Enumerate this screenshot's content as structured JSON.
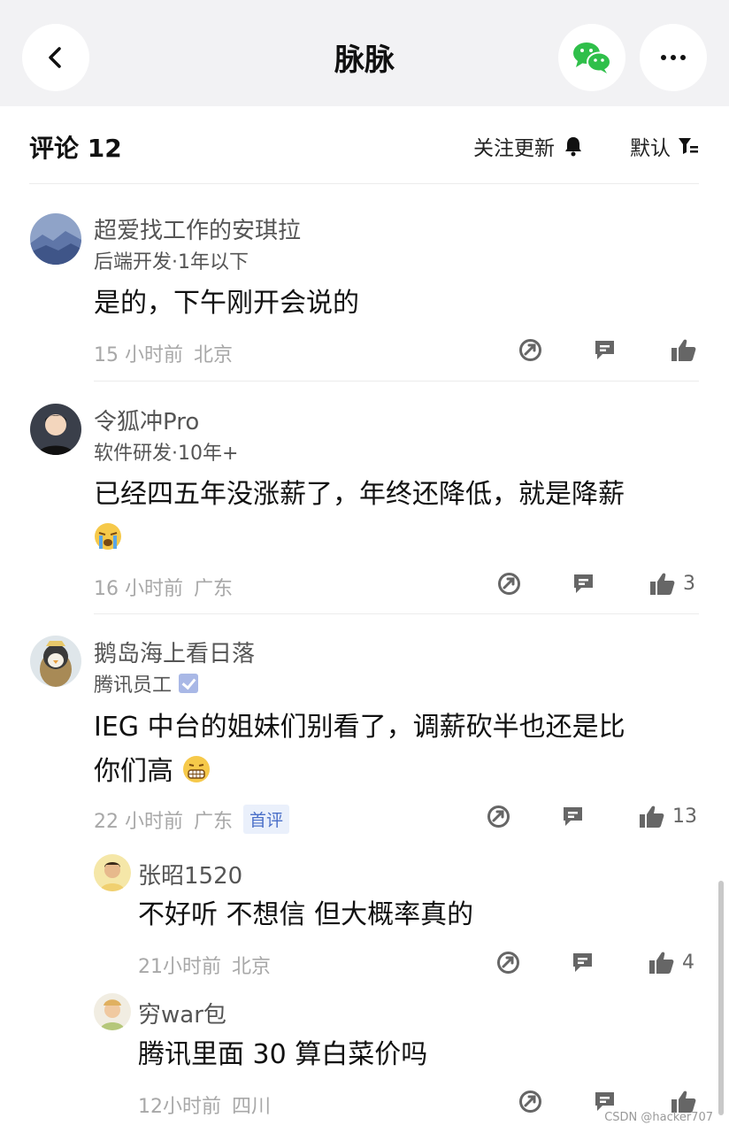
{
  "app": {
    "title": "脉脉",
    "icons": {
      "back": "back-arrow-icon",
      "share": "wechat-icon",
      "more": "more-dots-icon"
    }
  },
  "comments_header": {
    "label": "评论 12",
    "follow_updates": "关注更新",
    "sort": "默认"
  },
  "comments": [
    {
      "author": "超爱找工作的安琪拉",
      "role": "后端开发·1年以下",
      "content": "是的，下午刚开会说的",
      "time": "15 小时前",
      "location": "北京",
      "likes": ""
    },
    {
      "author": "令狐冲Pro",
      "role": "软件研发·10年+",
      "content": "已经四五年没涨薪了，年终还降低，就是降薪",
      "emoji": "crying-face-emoji",
      "time": "16 小时前",
      "location": "广东",
      "likes": "3"
    },
    {
      "author": "鹅岛海上看日落",
      "role": "腾讯员工",
      "verified": true,
      "content_line1": "IEG 中台的姐妹们别看了，调薪砍半也还是比",
      "content_line2": "你们高",
      "emoji": "grimacing-face-emoji",
      "time": "22 小时前",
      "location": "广东",
      "badge": "首评",
      "likes": "13"
    }
  ],
  "replies": [
    {
      "author": "张昭1520",
      "content": "不好听 不想信 但大概率真的",
      "time": "21小时前",
      "location": "北京",
      "likes": "4"
    },
    {
      "author": "穷war包",
      "content": "腾讯里面 30 算白菜价吗",
      "time": "12小时前",
      "location": "四川",
      "likes": ""
    }
  ],
  "watermark": "CSDN @hacker707"
}
